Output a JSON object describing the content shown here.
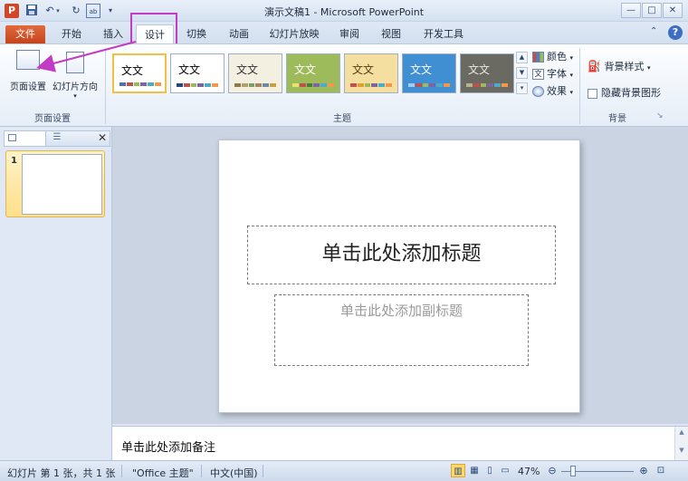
{
  "window": {
    "title": "演示文稿1 - Microsoft PowerPoint",
    "app_icon_letter": "P",
    "controls": {
      "minimize": "—",
      "maximize": "□",
      "close": "✕"
    },
    "qat": {
      "undo": "↶",
      "redo": "↻"
    }
  },
  "tabs": [
    {
      "label": "文件"
    },
    {
      "label": "开始"
    },
    {
      "label": "插入"
    },
    {
      "label": "设计"
    },
    {
      "label": "切换"
    },
    {
      "label": "动画"
    },
    {
      "label": "幻灯片放映"
    },
    {
      "label": "审阅"
    },
    {
      "label": "视图"
    },
    {
      "label": "开发工具"
    }
  ],
  "ribbon": {
    "page_setup": {
      "label": "页面设置",
      "button": "页面设置",
      "orientation": "幻灯片方向"
    },
    "themes": {
      "label": "主题",
      "items": [
        {
          "text": "文文",
          "bg": "#ffffff",
          "fg": "#000000",
          "bars": [
            "#4f6fb0",
            "#c0504d",
            "#9bbb59",
            "#8064a2",
            "#4bacc6",
            "#f79646"
          ]
        },
        {
          "text": "文文",
          "bg": "#ffffff",
          "fg": "#000000",
          "bars": [
            "#1f497d",
            "#c0504d",
            "#9bbb59",
            "#8064a2",
            "#4bacc6",
            "#f79646"
          ]
        },
        {
          "text": "文文",
          "bg": "#f3f0e2",
          "fg": "#333333",
          "bars": [
            "#8c7a4a",
            "#b0a06a",
            "#7f9c6a",
            "#a5835c",
            "#6a8aa5",
            "#c8a040"
          ]
        },
        {
          "text": "文文",
          "bg": "#9dbb5b",
          "fg": "#ffffff",
          "bars": [
            "#e9e36b",
            "#c0504d",
            "#4a7d3b",
            "#8064a2",
            "#4bacc6",
            "#f79646"
          ]
        },
        {
          "text": "文文",
          "bg": "#f5dfa0",
          "fg": "#5a3a10",
          "bars": [
            "#c0504d",
            "#e0a030",
            "#9bbb59",
            "#8064a2",
            "#4bacc6",
            "#f79646"
          ]
        },
        {
          "text": "文文",
          "bg": "#3f8fd2",
          "fg": "#ffffff",
          "bars": [
            "#9ad0f5",
            "#c0504d",
            "#9bbb59",
            "#8064a2",
            "#4bacc6",
            "#f79646"
          ]
        },
        {
          "text": "文文",
          "bg": "#6a6a62",
          "fg": "#e8e8e0",
          "bars": [
            "#b6b48a",
            "#c0504d",
            "#9bbb59",
            "#8064a2",
            "#4bacc6",
            "#f79646"
          ]
        }
      ],
      "colors": "颜色",
      "fonts": "字体",
      "effects": "效果"
    },
    "background": {
      "label": "背景",
      "styles": "背景样式",
      "hide_graphics": "隐藏背景图形"
    }
  },
  "slides_pane": {
    "slide_number": "1"
  },
  "slide": {
    "title_placeholder": "单击此处添加标题",
    "subtitle_placeholder": "单击此处添加副标题"
  },
  "notes": {
    "placeholder": "单击此处添加备注"
  },
  "status": {
    "slide_info": "幻灯片 第 1 张，共 1 张",
    "theme": "\"Office 主题\"",
    "language": "中文(中国)",
    "zoom": "47%"
  }
}
